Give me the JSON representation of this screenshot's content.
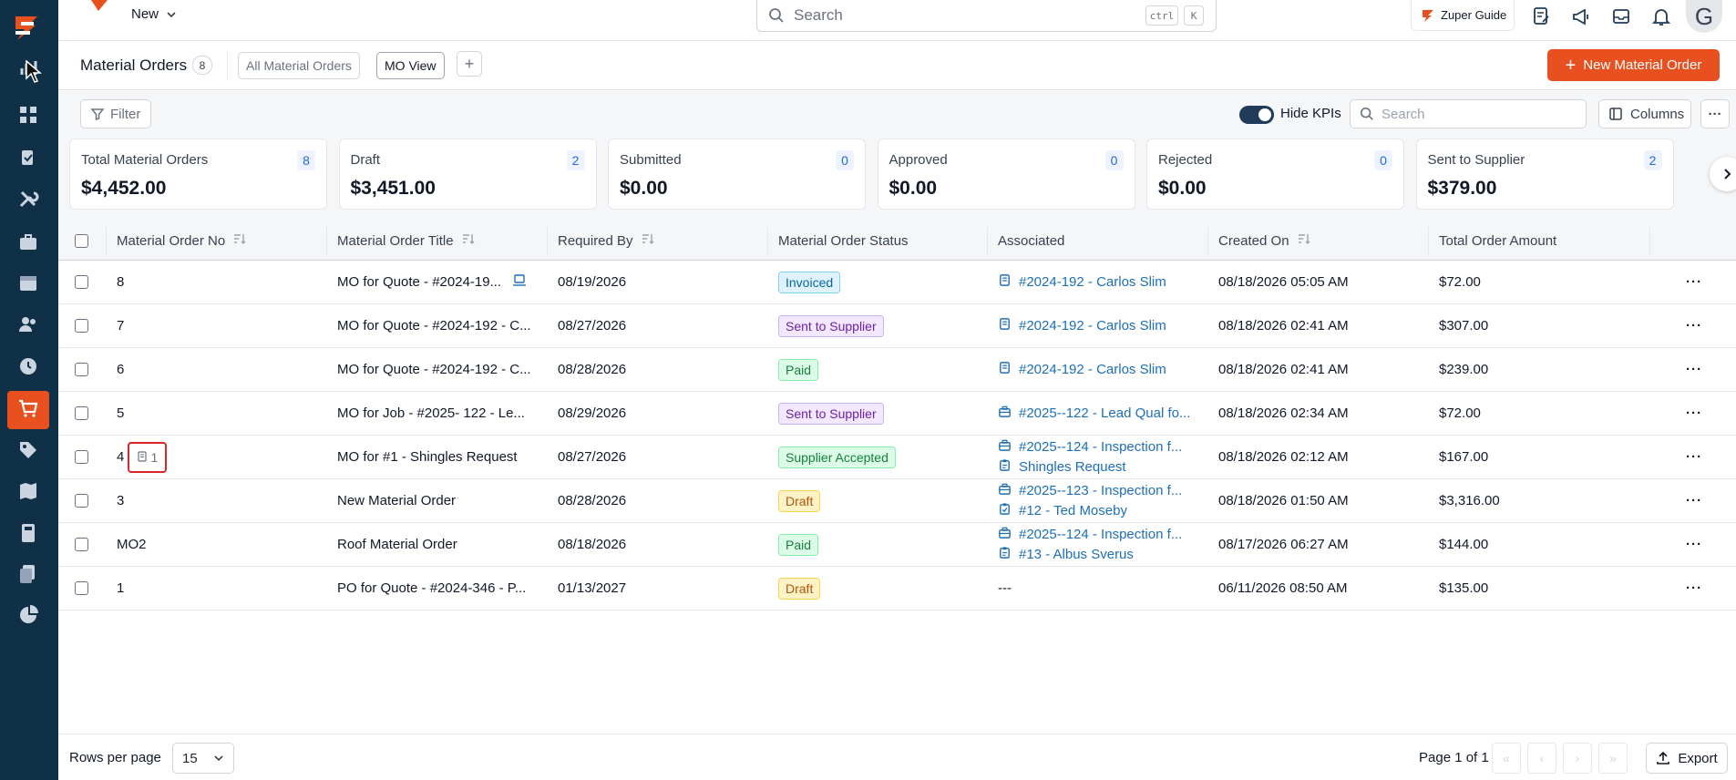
{
  "topbar": {
    "new_label": "New",
    "search_placeholder": "Search",
    "kbd_ctrl": "ctrl",
    "kbd_k": "K",
    "guide_label": "Zuper Guide",
    "avatar_letter": "G"
  },
  "colors": {
    "brand": "#e8511f",
    "sidebar": "#0f3047",
    "link": "#1d6fb8"
  },
  "sidebar": {
    "items": [
      {
        "icon": "dashboard-chart-icon"
      },
      {
        "icon": "apps-grid-icon"
      },
      {
        "icon": "jobs-icon"
      },
      {
        "icon": "tools-icon"
      },
      {
        "icon": "briefcase-icon"
      },
      {
        "icon": "calendar-icon"
      },
      {
        "icon": "users-icon"
      },
      {
        "icon": "clock-icon"
      },
      {
        "icon": "cart-icon",
        "active": true
      },
      {
        "icon": "tag-icon"
      },
      {
        "icon": "map-icon"
      },
      {
        "icon": "calculator-icon"
      },
      {
        "icon": "documents-icon"
      },
      {
        "icon": "pie-chart-icon"
      }
    ]
  },
  "header": {
    "title": "Material Orders",
    "count": "8",
    "views": [
      "All Material Orders",
      "MO View"
    ],
    "add_view": "+",
    "new_button": "New Material Order"
  },
  "toolbar": {
    "filter": "Filter",
    "hide_kpis": "Hide KPIs",
    "search_placeholder": "Search",
    "columns": "Columns",
    "more": "···"
  },
  "kpis": [
    {
      "label": "Total Material Orders",
      "count": "8",
      "value": "$4,452.00"
    },
    {
      "label": "Draft",
      "count": "2",
      "value": "$3,451.00"
    },
    {
      "label": "Submitted",
      "count": "0",
      "value": "$0.00"
    },
    {
      "label": "Approved",
      "count": "0",
      "value": "$0.00"
    },
    {
      "label": "Rejected",
      "count": "0",
      "value": "$0.00"
    },
    {
      "label": "Sent to Supplier",
      "count": "2",
      "value": "$379.00"
    }
  ],
  "table": {
    "columns": [
      "Material Order No",
      "Material Order Title",
      "Required By",
      "Material Order Status",
      "Associated",
      "Created On",
      "Total Order Amount"
    ],
    "rows": [
      {
        "no": "8",
        "title": "MO for Quote - #2024-19...",
        "required": "08/19/2026",
        "status": "Invoiced",
        "status_class": "b-invoiced",
        "assoc": [
          {
            "icon": "quote-icon",
            "text": "#2024-192 - Carlos Slim"
          }
        ],
        "created": "08/18/2026 05:05 AM",
        "amount": "$72.00"
      },
      {
        "no": "7",
        "title": "MO for Quote - #2024-192 - C...",
        "required": "08/27/2026",
        "status": "Sent to Supplier",
        "status_class": "b-sent",
        "assoc": [
          {
            "icon": "quote-icon",
            "text": "#2024-192 - Carlos Slim"
          }
        ],
        "created": "08/18/2026 02:41 AM",
        "amount": "$307.00"
      },
      {
        "no": "6",
        "title": "MO for Quote - #2024-192 - C...",
        "required": "08/28/2026",
        "status": "Paid",
        "status_class": "b-paid",
        "assoc": [
          {
            "icon": "quote-icon",
            "text": "#2024-192 - Carlos Slim"
          }
        ],
        "created": "08/18/2026 02:41 AM",
        "amount": "$239.00"
      },
      {
        "no": "5",
        "title": "MO for Job - #2025- 122 - Le...",
        "required": "08/29/2026",
        "status": "Sent to Supplier",
        "status_class": "b-sent",
        "assoc": [
          {
            "icon": "job-icon",
            "text": "#2025--122 - Lead Qual fo..."
          }
        ],
        "created": "08/18/2026 02:34 AM",
        "amount": "$72.00"
      },
      {
        "no": "4",
        "note_count": "1",
        "title": "MO for #1 - Shingles Request",
        "required": "08/27/2026",
        "status": "Supplier Accepted",
        "status_class": "b-accepted",
        "assoc": [
          {
            "icon": "job-icon",
            "text": "#2025--124 - Inspection f..."
          },
          {
            "icon": "request-icon",
            "text": "Shingles Request"
          }
        ],
        "created": "08/18/2026 02:12 AM",
        "amount": "$167.00"
      },
      {
        "no": "3",
        "title": "New Material Order",
        "required": "08/28/2026",
        "status": "Draft",
        "status_class": "b-draft",
        "assoc": [
          {
            "icon": "job-icon",
            "text": "#2025--123 - Inspection f..."
          },
          {
            "icon": "task-icon",
            "text": "#12 - Ted Moseby"
          }
        ],
        "created": "08/18/2026 01:50 AM",
        "amount": "$3,316.00"
      },
      {
        "no": "MO2",
        "title": "Roof Material Order",
        "required": "08/18/2026",
        "status": "Paid",
        "status_class": "b-paid",
        "assoc": [
          {
            "icon": "job-icon",
            "text": "#2025--124 - Inspection f..."
          },
          {
            "icon": "request-icon",
            "text": "#13 - Albus Sverus"
          }
        ],
        "created": "08/17/2026 06:27 AM",
        "amount": "$144.00"
      },
      {
        "no": "1",
        "title": "PO for Quote - #2024-346 - P...",
        "required": "01/13/2027",
        "status": "Draft",
        "status_class": "b-draft",
        "assoc_text": "---",
        "created": "06/11/2026 08:50 AM",
        "amount": "$135.00"
      }
    ]
  },
  "footer": {
    "rows_per_page_label": "Rows per page",
    "rows_per_page": "15",
    "page_info": "Page 1 of 1",
    "export": "Export"
  }
}
